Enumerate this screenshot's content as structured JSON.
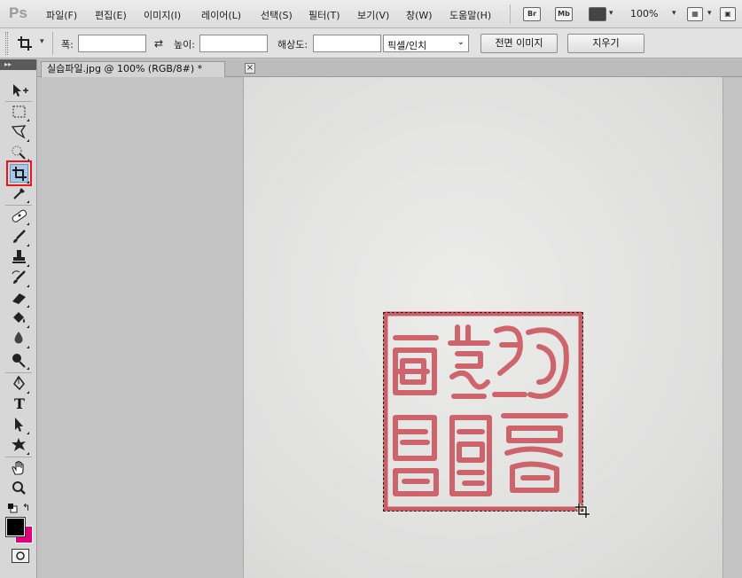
{
  "app": {
    "logo": "Ps"
  },
  "menu": {
    "items": [
      "파일(F)",
      "편집(E)",
      "이미지(I)",
      "레이어(L)",
      "선택(S)",
      "필터(T)",
      "보기(V)",
      "창(W)",
      "도움말(H)"
    ],
    "bridge_icon": "Br",
    "minibridge_icon": "Mb",
    "zoom": "100%"
  },
  "options": {
    "width_label": "폭:",
    "width_value": "",
    "height_label": "높이:",
    "height_value": "",
    "resolution_label": "해상도:",
    "resolution_value": "",
    "unit": "픽셀/인치",
    "front_image_button": "전면 이미지",
    "clear_button": "지우기"
  },
  "toolbar": {
    "selected_tool": "crop-tool",
    "icons": [
      "move-icon",
      "marquee-icon",
      "lasso-icon",
      "quick-selection-icon",
      "crop-icon",
      "eyedropper-icon",
      "healing-brush-icon",
      "brush-icon",
      "clone-stamp-icon",
      "history-brush-icon",
      "eraser-icon",
      "paint-bucket-icon",
      "blur-icon",
      "dodge-icon",
      "pen-icon",
      "type-icon",
      "path-selection-icon",
      "custom-shape-icon",
      "hand-icon",
      "zoom-icon"
    ],
    "type_glyph": "T",
    "foreground_color": "#000000",
    "background_color": "#e0007a"
  },
  "document": {
    "tab_title": "실습파일.jpg @ 100% (RGB/8#) *",
    "close_glyph": "×",
    "canvas_image": "red square seal stamp on white paper"
  },
  "colors": {
    "accent_highlight": "#e8161f",
    "seal_red": "#c8444e",
    "selected_tool_bg": "#a9c7e6"
  }
}
